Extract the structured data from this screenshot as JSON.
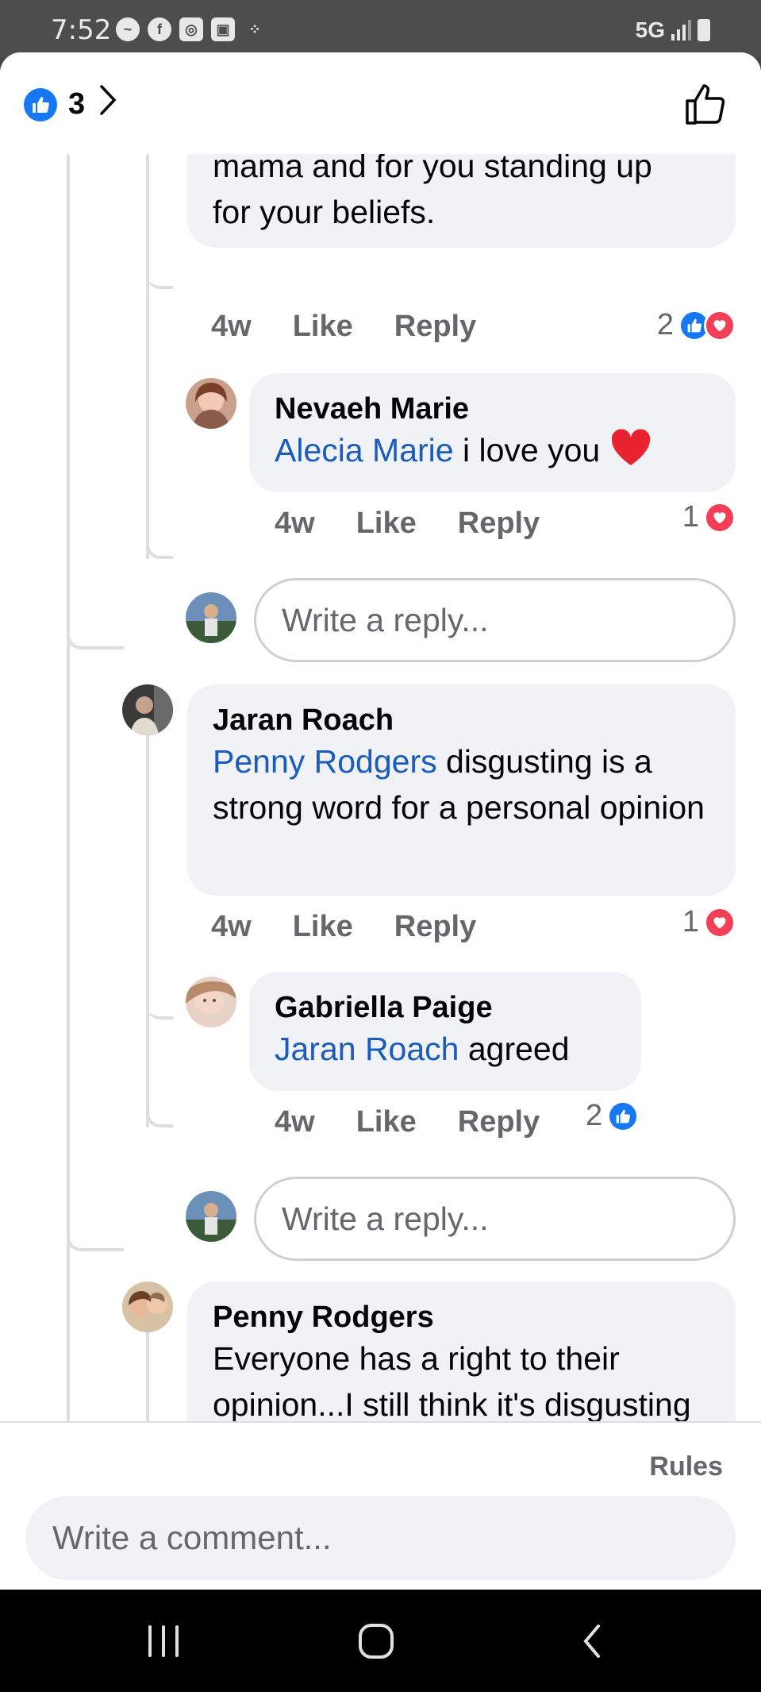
{
  "status_bar": {
    "time": "7:52",
    "network": "5G",
    "app_icons": [
      "messenger-icon",
      "facebook-icon",
      "instagram-icon",
      "gallery-icon",
      "dots-icon"
    ]
  },
  "header": {
    "reaction_count": "3"
  },
  "comments": [
    {
      "text": "mama and for you standing up for your beliefs.",
      "time": "4w",
      "like": "Like",
      "reply": "Reply",
      "reaction_count": "2",
      "reactions": [
        "like",
        "love"
      ]
    },
    {
      "author": "Nevaeh Marie",
      "mention": "Alecia Marie",
      "text": " i love you ",
      "emoji": "❤️",
      "time": "4w",
      "like": "Like",
      "reply": "Reply",
      "reaction_count": "1",
      "reactions": [
        "love"
      ]
    },
    {
      "author": "Jaran Roach",
      "mention": "Penny Rodgers",
      "text": " disgusting is a strong word for a personal opinion",
      "time": "4w",
      "like": "Like",
      "reply": "Reply",
      "reaction_count": "1",
      "reactions": [
        "love"
      ]
    },
    {
      "author": "Gabriella Paige",
      "mention": "Jaran Roach",
      "text": " agreed",
      "time": "4w",
      "like": "Like",
      "reply": "Reply",
      "reaction_count": "2",
      "reactions": [
        "like"
      ]
    },
    {
      "author": "Penny Rodgers",
      "text": "Everyone has a right to their opinion...I still think it's disgusting and so does"
    }
  ],
  "reply_placeholder": "Write a reply...",
  "footer": {
    "rules": "Rules",
    "comment_placeholder": "Write a comment..."
  },
  "colors": {
    "accent": "#1877f2",
    "love": "#f33e58",
    "mention": "#1a5bbf",
    "bubble": "#f0f2f5"
  }
}
